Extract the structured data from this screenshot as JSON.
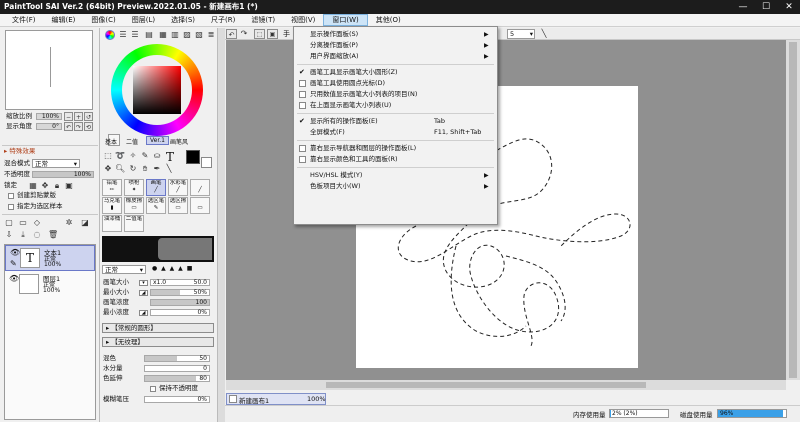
{
  "window": {
    "title": "PaintTool SAI Ver.2 (64bit) Preview.2022.01.05 - 新建画布1 (*)",
    "minimize": "—",
    "maximize": "☐",
    "close": "✕"
  },
  "menu": [
    "文件(F)",
    "编辑(E)",
    "图像(C)",
    "图层(L)",
    "选择(S)",
    "尺子(R)",
    "滤镜(T)",
    "视图(V)",
    "窗口(W)",
    "其他(O)"
  ],
  "navigator": {
    "zoom_label": "缩放比例",
    "zoom_value": "100%",
    "angle_label": "显示角度",
    "angle_value": "0°"
  },
  "layer_panel": {
    "special_effects": "特殊效果",
    "blend_label": "混合模式",
    "blend_value": "正常",
    "opacity_label": "不透明度",
    "opacity_value": "100%",
    "opacity_level": 1.0,
    "lock_label": "锁定",
    "clip_label": "创建剪贴蒙版",
    "select_source_label": "指定为选区样本",
    "layers": [
      {
        "name": "文本1",
        "mode": "正常",
        "opacity": "100%",
        "thumb": "T"
      },
      {
        "name": "图层1",
        "mode": "正常",
        "opacity": "100%",
        "thumb": ""
      }
    ]
  },
  "color_panel": {
    "tabs": [
      "基本",
      "二值",
      "Ver.1",
      "画笔风"
    ],
    "active_tab": "Ver.1",
    "main_color": "#000000",
    "hue_color": "#ff0000"
  },
  "tools": {
    "row1": [
      "铅笔",
      "喷枪",
      "画笔",
      "水彩笔",
      ""
    ],
    "row2": [
      "马克笔",
      "橡皮擦",
      "选区笔",
      "选区擦",
      ""
    ],
    "row3": [
      "油漆桶",
      "二值笔"
    ],
    "selected": "画笔"
  },
  "brush": {
    "mode": "正常",
    "size_label": "画笔大小",
    "size_mult": "x1.0",
    "size_value": "50.0",
    "min_size_label": "最小大小",
    "min_size_value": "50%",
    "min_size_level": 0.5,
    "density_label": "画笔浓度",
    "density_value": "100",
    "density_level": 1.0,
    "min_density_label": "最小浓度",
    "min_density_value": "0%",
    "min_density_level": 0.0,
    "shape_label": "【常规的圆形】",
    "texture_label": "【无纹理】",
    "blend_label": "混色",
    "blend_value": "50",
    "blend_level": 0.5,
    "water_label": "水分量",
    "water_value": "0",
    "water_level": 0.0,
    "color_extend_label": "色延伸",
    "color_extend_value": "80",
    "color_extend_level": 0.8,
    "keep_opacity_label": "保持不透明度",
    "blur_label": "模糊笔压",
    "blur_value": "0%"
  },
  "options_bar": {
    "hand_label": "手",
    "size_value": "5"
  },
  "dropdown": [
    {
      "type": "item",
      "check": "",
      "label": "显示操作面板(S)",
      "shortcut": "",
      "submenu": true
    },
    {
      "type": "item",
      "check": "",
      "label": "分离操作面板(P)",
      "shortcut": "",
      "submenu": true
    },
    {
      "type": "item",
      "check": "",
      "label": "用户界面缩放(A)",
      "shortcut": "",
      "submenu": true
    },
    {
      "type": "sep"
    },
    {
      "type": "item",
      "check": "✔",
      "label": "画笔工具显示画笔大小圆形(Z)",
      "shortcut": "",
      "submenu": false
    },
    {
      "type": "item",
      "check": "box",
      "label": "画笔工具使用圆点光标(D)",
      "shortcut": "",
      "submenu": false
    },
    {
      "type": "item",
      "check": "box",
      "label": "只用数值显示画笔大小列表的项目(N)",
      "shortcut": "",
      "submenu": false
    },
    {
      "type": "item",
      "check": "box",
      "label": "在上面显示画笔大小列表(U)",
      "shortcut": "",
      "submenu": false
    },
    {
      "type": "sep"
    },
    {
      "type": "item",
      "check": "✔",
      "label": "显示所有的操作面板(E)",
      "shortcut": "Tab",
      "submenu": false
    },
    {
      "type": "item",
      "check": "",
      "label": "全屏模式(F)",
      "shortcut": "F11, Shift+Tab",
      "submenu": false
    },
    {
      "type": "sep"
    },
    {
      "type": "item",
      "check": "box",
      "label": "靠右显示导航器和图层的操作面板(L)",
      "shortcut": "",
      "submenu": false
    },
    {
      "type": "item",
      "check": "box",
      "label": "靠右显示颜色和工具的面板(R)",
      "shortcut": "",
      "submenu": false
    },
    {
      "type": "sep"
    },
    {
      "type": "item",
      "check": "",
      "label": "HSV/HSL 模式(Y)",
      "shortcut": "",
      "submenu": true
    },
    {
      "type": "item",
      "check": "",
      "label": "色板项目大小(W)",
      "shortcut": "",
      "submenu": true
    }
  ],
  "doc_tab": {
    "name": "新建画布1",
    "zoom": "100%"
  },
  "status": {
    "memory_label": "内存使用量",
    "memory_value": "2% (2%)",
    "memory_level": 0.02,
    "disk_label": "磁盘使用量",
    "disk_value": "96%",
    "disk_level": 0.96,
    "disk_color": "#3aa0e8"
  }
}
